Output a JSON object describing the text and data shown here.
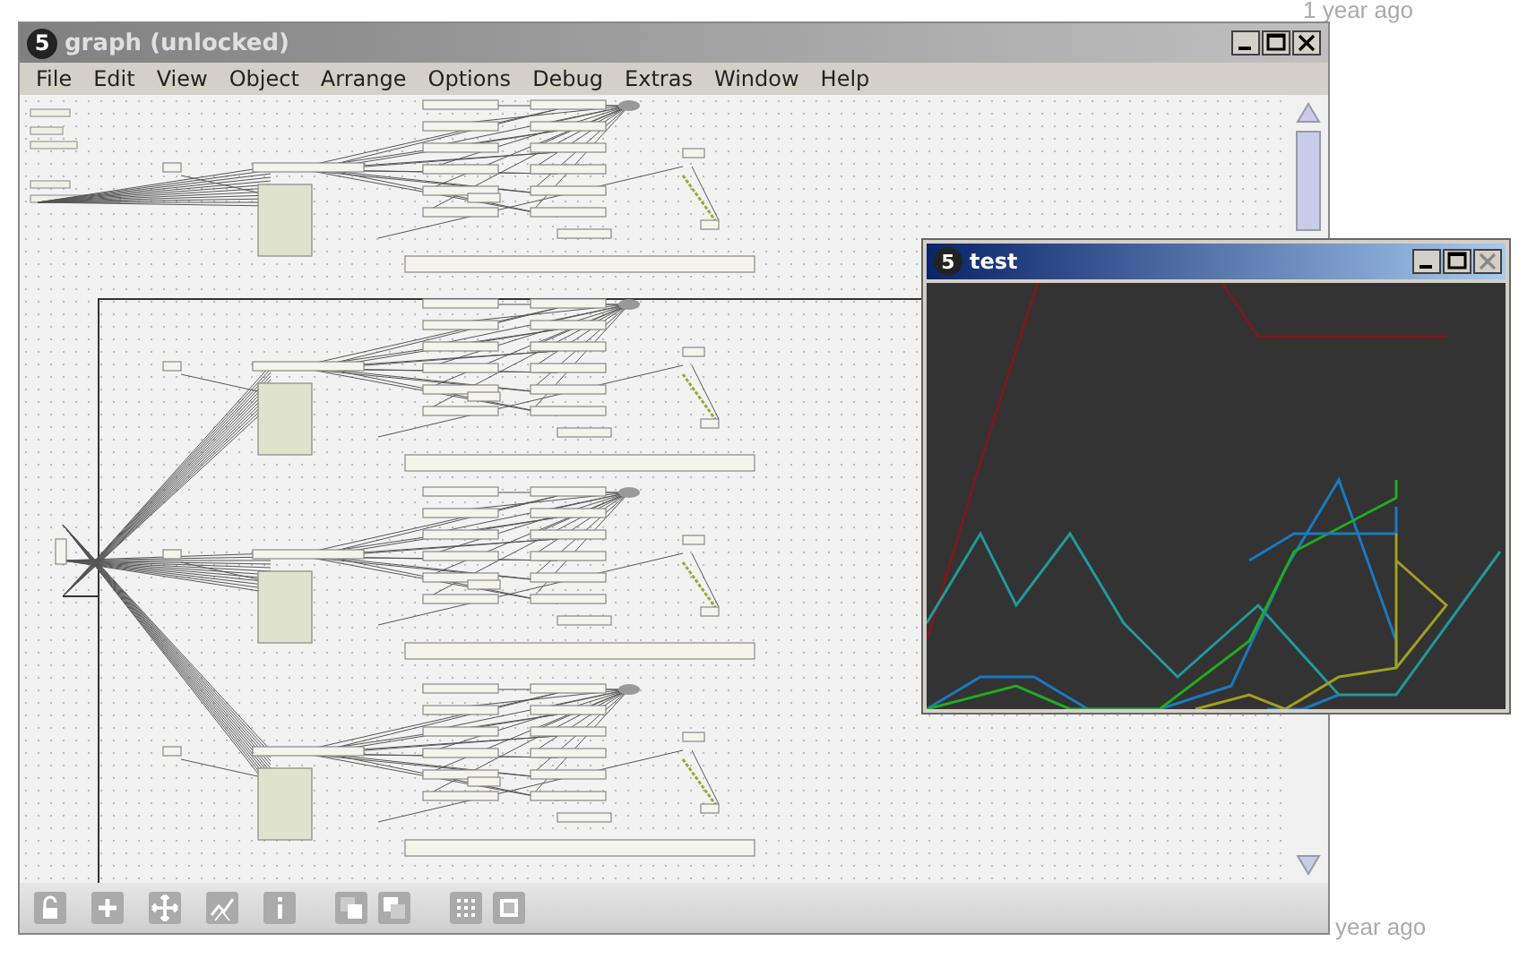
{
  "background": {
    "timestamps": [
      "1 year ago",
      "year ago"
    ]
  },
  "patcher": {
    "badge": "5",
    "title": "graph (unlocked)",
    "menu": [
      "File",
      "Edit",
      "View",
      "Object",
      "Arrange",
      "Options",
      "Debug",
      "Extras",
      "Window",
      "Help"
    ]
  },
  "plot_window": {
    "badge": "5",
    "title": "test"
  }
}
